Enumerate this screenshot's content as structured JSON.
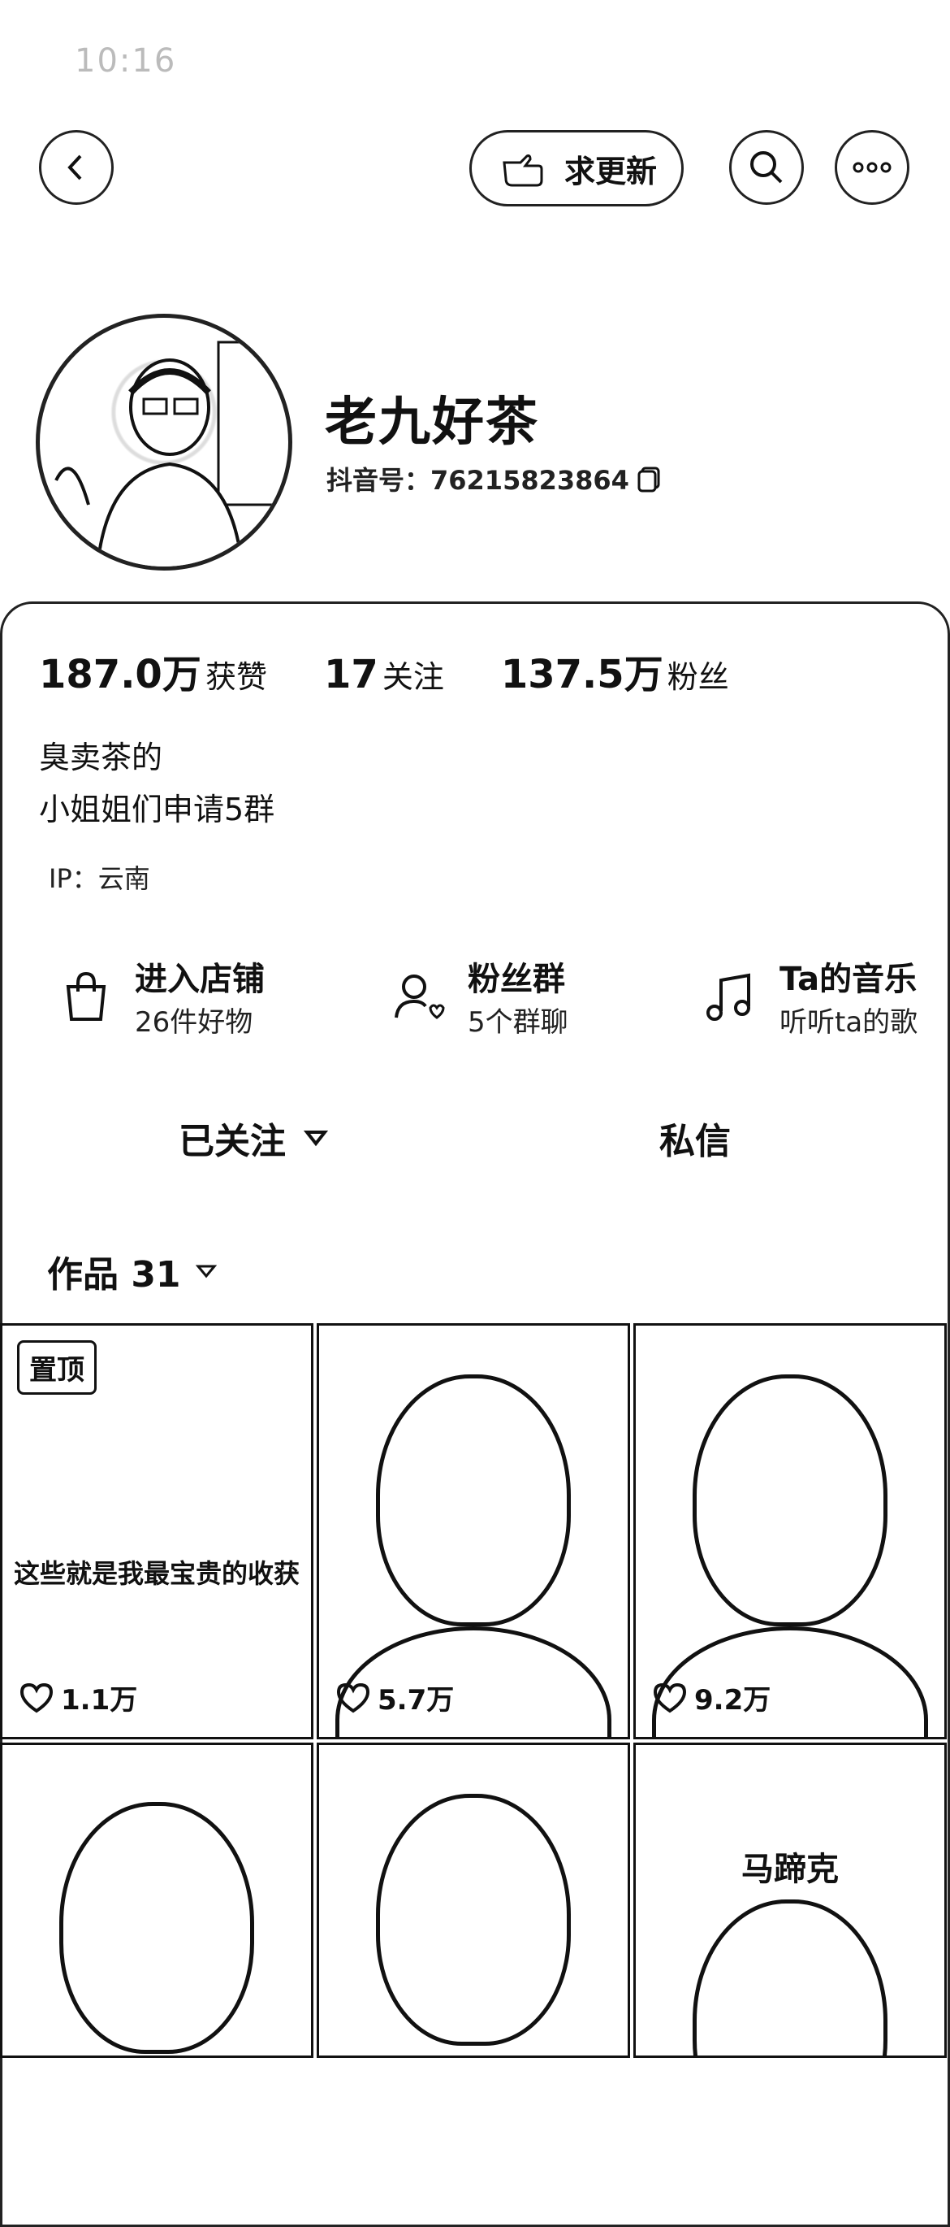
{
  "status_bar": {
    "time": "10:16"
  },
  "header": {
    "request_update_label": "求更新"
  },
  "profile": {
    "name": "老九好茶",
    "douyin_id": "抖音号：76215823864"
  },
  "stats": [
    {
      "value": "187.0万",
      "label": "获赞"
    },
    {
      "value": "17",
      "label": "关注"
    },
    {
      "value": "137.5万",
      "label": "粉丝"
    }
  ],
  "bio": {
    "line1": "臭卖茶的",
    "line2": "小姐姐们申请5群",
    "ip": "IP：云南"
  },
  "services": [
    {
      "title": "进入店铺",
      "subtitle": "26件好物",
      "icon": "shopping-bag-icon"
    },
    {
      "title": "粉丝群",
      "subtitle": "5个群聊",
      "icon": "fan-group-icon"
    },
    {
      "title": "Ta的音乐",
      "subtitle": "听听ta的歌",
      "icon": "music-note-icon"
    }
  ],
  "actions": {
    "follow_label": "已关注",
    "message_label": "私信"
  },
  "works_tab": {
    "label": "作品 31"
  },
  "videos": [
    {
      "pinned": "置顶",
      "caption": "这些就是我最宝贵的收获",
      "likes": "1.1万"
    },
    {
      "likes": "5.7万"
    },
    {
      "likes": "9.2万"
    },
    {
      "likes": ""
    },
    {
      "likes": ""
    },
    {
      "overlay": "马蹄克",
      "likes": ""
    }
  ]
}
